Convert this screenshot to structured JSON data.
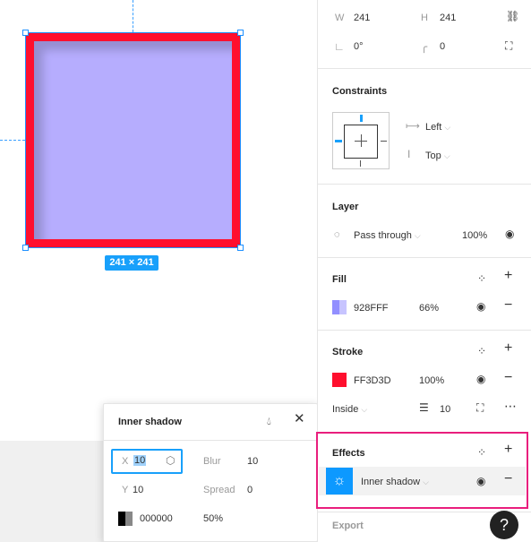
{
  "canvas": {
    "size_badge": "241 × 241",
    "colors": {
      "fill": "#B6ADFE",
      "stroke": "#FF0F2E",
      "selection": "#1E90FF"
    }
  },
  "popup": {
    "title": "Inner shadow",
    "x_label": "X",
    "x_value": "10",
    "y_label": "Y",
    "y_value": "10",
    "blur_label": "Blur",
    "blur_value": "10",
    "spread_label": "Spread",
    "spread_value": "0",
    "color_hex": "000000",
    "opacity": "50%"
  },
  "panel": {
    "transform": {
      "w_label": "W",
      "w_value": "241",
      "h_label": "H",
      "h_value": "241",
      "rotation": "0°",
      "radius": "0"
    },
    "constraints": {
      "title": "Constraints",
      "horizontal": "Left",
      "vertical": "Top"
    },
    "layer": {
      "title": "Layer",
      "blend": "Pass through",
      "opacity": "100%"
    },
    "fill": {
      "title": "Fill",
      "hex": "928FFF",
      "opacity": "66%",
      "color": "#928FFF"
    },
    "stroke": {
      "title": "Stroke",
      "hex": "FF3D3D",
      "opacity": "100%",
      "position": "Inside",
      "weight": "10",
      "color": "#FF0F2E"
    },
    "effects": {
      "title": "Effects",
      "effect_type": "Inner shadow"
    },
    "export": {
      "title": "Export"
    },
    "help_label": "?"
  }
}
